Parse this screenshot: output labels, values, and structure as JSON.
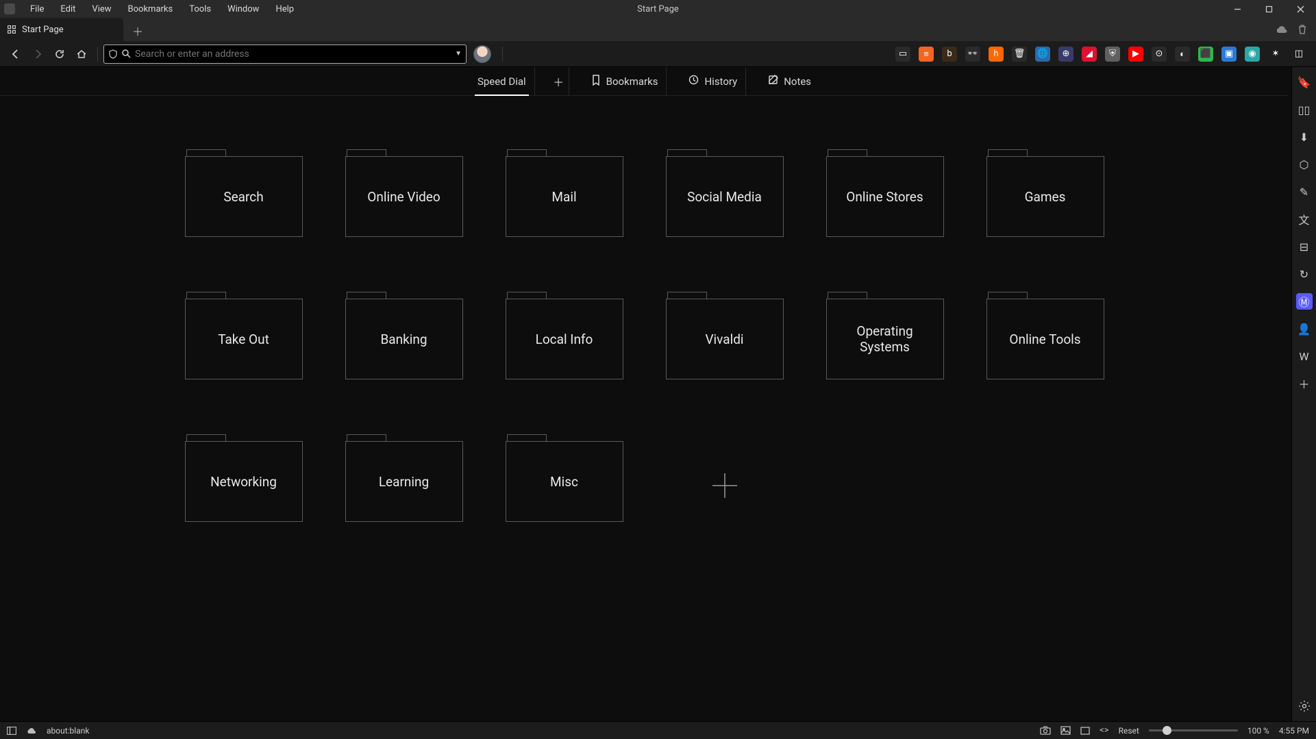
{
  "window": {
    "title": "Start Page",
    "menu": [
      "File",
      "Edit",
      "View",
      "Bookmarks",
      "Tools",
      "Window",
      "Help"
    ]
  },
  "tabs": {
    "active": {
      "label": "Start Page"
    }
  },
  "address": {
    "placeholder": "Search or enter an address"
  },
  "start_nav": {
    "speed_dial": "Speed Dial",
    "bookmarks": "Bookmarks",
    "history": "History",
    "notes": "Notes"
  },
  "speed_dial_folders": [
    "Search",
    "Online Video",
    "Mail",
    "Social Media",
    "Online Stores",
    "Games",
    "Take Out",
    "Banking",
    "Local Info",
    "Vivaldi",
    "Operating Systems",
    "Online Tools",
    "Networking",
    "Learning",
    "Misc"
  ],
  "extensions": [
    {
      "name": "reader-view",
      "bg": "#2a2a2a",
      "glyph": "▭"
    },
    {
      "name": "rss",
      "bg": "#f26522",
      "glyph": "≡"
    },
    {
      "name": "brave",
      "bg": "#3a2a1a",
      "glyph": "b"
    },
    {
      "name": "darkreader",
      "bg": "#2a2a2a",
      "glyph": "👓"
    },
    {
      "name": "honey",
      "bg": "#ff6600",
      "glyph": "h"
    },
    {
      "name": "trash",
      "bg": "#2a2a2a",
      "glyph": "🗑"
    },
    {
      "name": "globe",
      "bg": "#2a6aa8",
      "glyph": "🌐"
    },
    {
      "name": "globe2",
      "bg": "#3a3a6a",
      "glyph": "⊕"
    },
    {
      "name": "red-ext",
      "bg": "#e01030",
      "glyph": "◢"
    },
    {
      "name": "ublock",
      "bg": "#606060",
      "glyph": "⛨"
    },
    {
      "name": "youtube",
      "bg": "#ff0000",
      "glyph": "▶"
    },
    {
      "name": "steam",
      "bg": "#2a2a2a",
      "glyph": "⊙"
    },
    {
      "name": "toggle",
      "bg": "#2a2a2a",
      "glyph": "◐"
    },
    {
      "name": "green-ext",
      "bg": "#2db84d",
      "glyph": "⬛"
    },
    {
      "name": "blue-ext",
      "bg": "#2a7ad4",
      "glyph": "▣"
    },
    {
      "name": "teal-ext",
      "bg": "#2aa8a8",
      "glyph": "◉"
    },
    {
      "name": "extensions",
      "bg": "transparent",
      "glyph": "✶"
    },
    {
      "name": "panel-toggle",
      "bg": "transparent",
      "glyph": "◫"
    }
  ],
  "side_panel": [
    {
      "name": "bookmarks-panel",
      "glyph": "🔖"
    },
    {
      "name": "reading-list-panel",
      "glyph": "▯▯"
    },
    {
      "name": "downloads-panel",
      "glyph": "⬇"
    },
    {
      "name": "history-panel",
      "glyph": "⬡"
    },
    {
      "name": "notes-panel",
      "glyph": "✎"
    },
    {
      "name": "translate-panel",
      "glyph": "文"
    },
    {
      "name": "window-panel",
      "glyph": "⊟"
    },
    {
      "name": "sessions-panel",
      "glyph": "↻"
    },
    {
      "name": "mastodon-panel",
      "glyph": "Ⓜ",
      "bg": "#595aff"
    },
    {
      "name": "profile-panel",
      "glyph": "👤"
    },
    {
      "name": "wiki-panel",
      "glyph": "W"
    },
    {
      "name": "add-panel",
      "glyph": "＋"
    }
  ],
  "status": {
    "url": "about:blank",
    "reset": "Reset",
    "zoom": "100 %",
    "time": "4:55 PM"
  }
}
